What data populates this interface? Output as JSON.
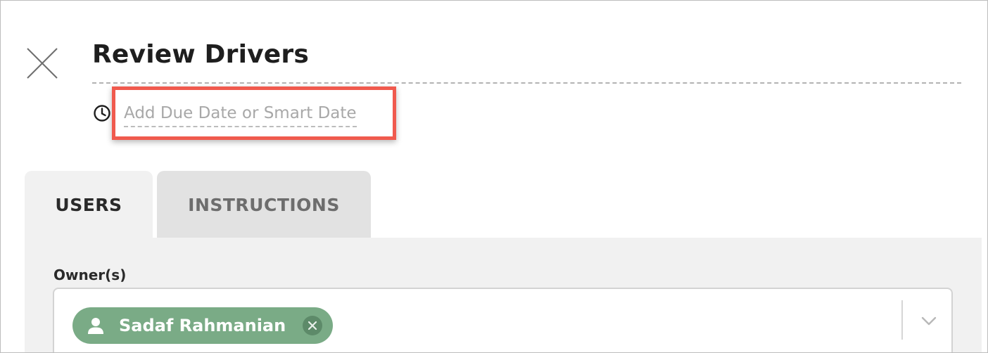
{
  "dialog": {
    "title": "Review Drivers"
  },
  "due_date": {
    "placeholder": "Add Due Date or Smart Date"
  },
  "tabs": [
    {
      "label": "USERS",
      "active": true
    },
    {
      "label": "INSTRUCTIONS",
      "active": false
    }
  ],
  "owners": {
    "label": "Owner(s)",
    "selected": [
      {
        "name": "Sadaf Rahmanian"
      }
    ]
  },
  "icons": {
    "close": "close-icon",
    "clock": "clock-icon",
    "user": "user-icon",
    "remove": "remove-circle-icon",
    "chevron": "chevron-down-icon"
  },
  "colors": {
    "highlight": "#f05a4e",
    "chip": "#7aab86"
  }
}
